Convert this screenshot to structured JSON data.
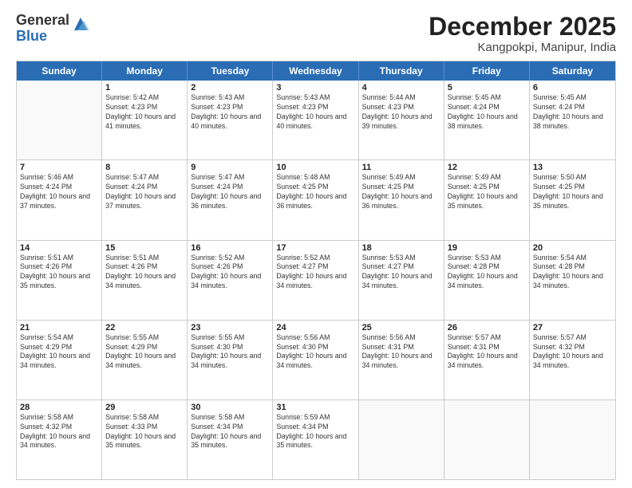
{
  "logo": {
    "general": "General",
    "blue": "Blue"
  },
  "title": "December 2025",
  "location": "Kangpokpi, Manipur, India",
  "weekdays": [
    "Sunday",
    "Monday",
    "Tuesday",
    "Wednesday",
    "Thursday",
    "Friday",
    "Saturday"
  ],
  "rows": [
    [
      {
        "day": "",
        "sunrise": "",
        "sunset": "",
        "daylight": ""
      },
      {
        "day": "1",
        "sunrise": "Sunrise: 5:42 AM",
        "sunset": "Sunset: 4:23 PM",
        "daylight": "Daylight: 10 hours and 41 minutes."
      },
      {
        "day": "2",
        "sunrise": "Sunrise: 5:43 AM",
        "sunset": "Sunset: 4:23 PM",
        "daylight": "Daylight: 10 hours and 40 minutes."
      },
      {
        "day": "3",
        "sunrise": "Sunrise: 5:43 AM",
        "sunset": "Sunset: 4:23 PM",
        "daylight": "Daylight: 10 hours and 40 minutes."
      },
      {
        "day": "4",
        "sunrise": "Sunrise: 5:44 AM",
        "sunset": "Sunset: 4:23 PM",
        "daylight": "Daylight: 10 hours and 39 minutes."
      },
      {
        "day": "5",
        "sunrise": "Sunrise: 5:45 AM",
        "sunset": "Sunset: 4:24 PM",
        "daylight": "Daylight: 10 hours and 38 minutes."
      },
      {
        "day": "6",
        "sunrise": "Sunrise: 5:45 AM",
        "sunset": "Sunset: 4:24 PM",
        "daylight": "Daylight: 10 hours and 38 minutes."
      }
    ],
    [
      {
        "day": "7",
        "sunrise": "Sunrise: 5:46 AM",
        "sunset": "Sunset: 4:24 PM",
        "daylight": "Daylight: 10 hours and 37 minutes."
      },
      {
        "day": "8",
        "sunrise": "Sunrise: 5:47 AM",
        "sunset": "Sunset: 4:24 PM",
        "daylight": "Daylight: 10 hours and 37 minutes."
      },
      {
        "day": "9",
        "sunrise": "Sunrise: 5:47 AM",
        "sunset": "Sunset: 4:24 PM",
        "daylight": "Daylight: 10 hours and 36 minutes."
      },
      {
        "day": "10",
        "sunrise": "Sunrise: 5:48 AM",
        "sunset": "Sunset: 4:25 PM",
        "daylight": "Daylight: 10 hours and 36 minutes."
      },
      {
        "day": "11",
        "sunrise": "Sunrise: 5:49 AM",
        "sunset": "Sunset: 4:25 PM",
        "daylight": "Daylight: 10 hours and 36 minutes."
      },
      {
        "day": "12",
        "sunrise": "Sunrise: 5:49 AM",
        "sunset": "Sunset: 4:25 PM",
        "daylight": "Daylight: 10 hours and 35 minutes."
      },
      {
        "day": "13",
        "sunrise": "Sunrise: 5:50 AM",
        "sunset": "Sunset: 4:25 PM",
        "daylight": "Daylight: 10 hours and 35 minutes."
      }
    ],
    [
      {
        "day": "14",
        "sunrise": "Sunrise: 5:51 AM",
        "sunset": "Sunset: 4:26 PM",
        "daylight": "Daylight: 10 hours and 35 minutes."
      },
      {
        "day": "15",
        "sunrise": "Sunrise: 5:51 AM",
        "sunset": "Sunset: 4:26 PM",
        "daylight": "Daylight: 10 hours and 34 minutes."
      },
      {
        "day": "16",
        "sunrise": "Sunrise: 5:52 AM",
        "sunset": "Sunset: 4:26 PM",
        "daylight": "Daylight: 10 hours and 34 minutes."
      },
      {
        "day": "17",
        "sunrise": "Sunrise: 5:52 AM",
        "sunset": "Sunset: 4:27 PM",
        "daylight": "Daylight: 10 hours and 34 minutes."
      },
      {
        "day": "18",
        "sunrise": "Sunrise: 5:53 AM",
        "sunset": "Sunset: 4:27 PM",
        "daylight": "Daylight: 10 hours and 34 minutes."
      },
      {
        "day": "19",
        "sunrise": "Sunrise: 5:53 AM",
        "sunset": "Sunset: 4:28 PM",
        "daylight": "Daylight: 10 hours and 34 minutes."
      },
      {
        "day": "20",
        "sunrise": "Sunrise: 5:54 AM",
        "sunset": "Sunset: 4:28 PM",
        "daylight": "Daylight: 10 hours and 34 minutes."
      }
    ],
    [
      {
        "day": "21",
        "sunrise": "Sunrise: 5:54 AM",
        "sunset": "Sunset: 4:29 PM",
        "daylight": "Daylight: 10 hours and 34 minutes."
      },
      {
        "day": "22",
        "sunrise": "Sunrise: 5:55 AM",
        "sunset": "Sunset: 4:29 PM",
        "daylight": "Daylight: 10 hours and 34 minutes."
      },
      {
        "day": "23",
        "sunrise": "Sunrise: 5:55 AM",
        "sunset": "Sunset: 4:30 PM",
        "daylight": "Daylight: 10 hours and 34 minutes."
      },
      {
        "day": "24",
        "sunrise": "Sunrise: 5:56 AM",
        "sunset": "Sunset: 4:30 PM",
        "daylight": "Daylight: 10 hours and 34 minutes."
      },
      {
        "day": "25",
        "sunrise": "Sunrise: 5:56 AM",
        "sunset": "Sunset: 4:31 PM",
        "daylight": "Daylight: 10 hours and 34 minutes."
      },
      {
        "day": "26",
        "sunrise": "Sunrise: 5:57 AM",
        "sunset": "Sunset: 4:31 PM",
        "daylight": "Daylight: 10 hours and 34 minutes."
      },
      {
        "day": "27",
        "sunrise": "Sunrise: 5:57 AM",
        "sunset": "Sunset: 4:32 PM",
        "daylight": "Daylight: 10 hours and 34 minutes."
      }
    ],
    [
      {
        "day": "28",
        "sunrise": "Sunrise: 5:58 AM",
        "sunset": "Sunset: 4:32 PM",
        "daylight": "Daylight: 10 hours and 34 minutes."
      },
      {
        "day": "29",
        "sunrise": "Sunrise: 5:58 AM",
        "sunset": "Sunset: 4:33 PM",
        "daylight": "Daylight: 10 hours and 35 minutes."
      },
      {
        "day": "30",
        "sunrise": "Sunrise: 5:58 AM",
        "sunset": "Sunset: 4:34 PM",
        "daylight": "Daylight: 10 hours and 35 minutes."
      },
      {
        "day": "31",
        "sunrise": "Sunrise: 5:59 AM",
        "sunset": "Sunset: 4:34 PM",
        "daylight": "Daylight: 10 hours and 35 minutes."
      },
      {
        "day": "",
        "sunrise": "",
        "sunset": "",
        "daylight": ""
      },
      {
        "day": "",
        "sunrise": "",
        "sunset": "",
        "daylight": ""
      },
      {
        "day": "",
        "sunrise": "",
        "sunset": "",
        "daylight": ""
      }
    ]
  ]
}
